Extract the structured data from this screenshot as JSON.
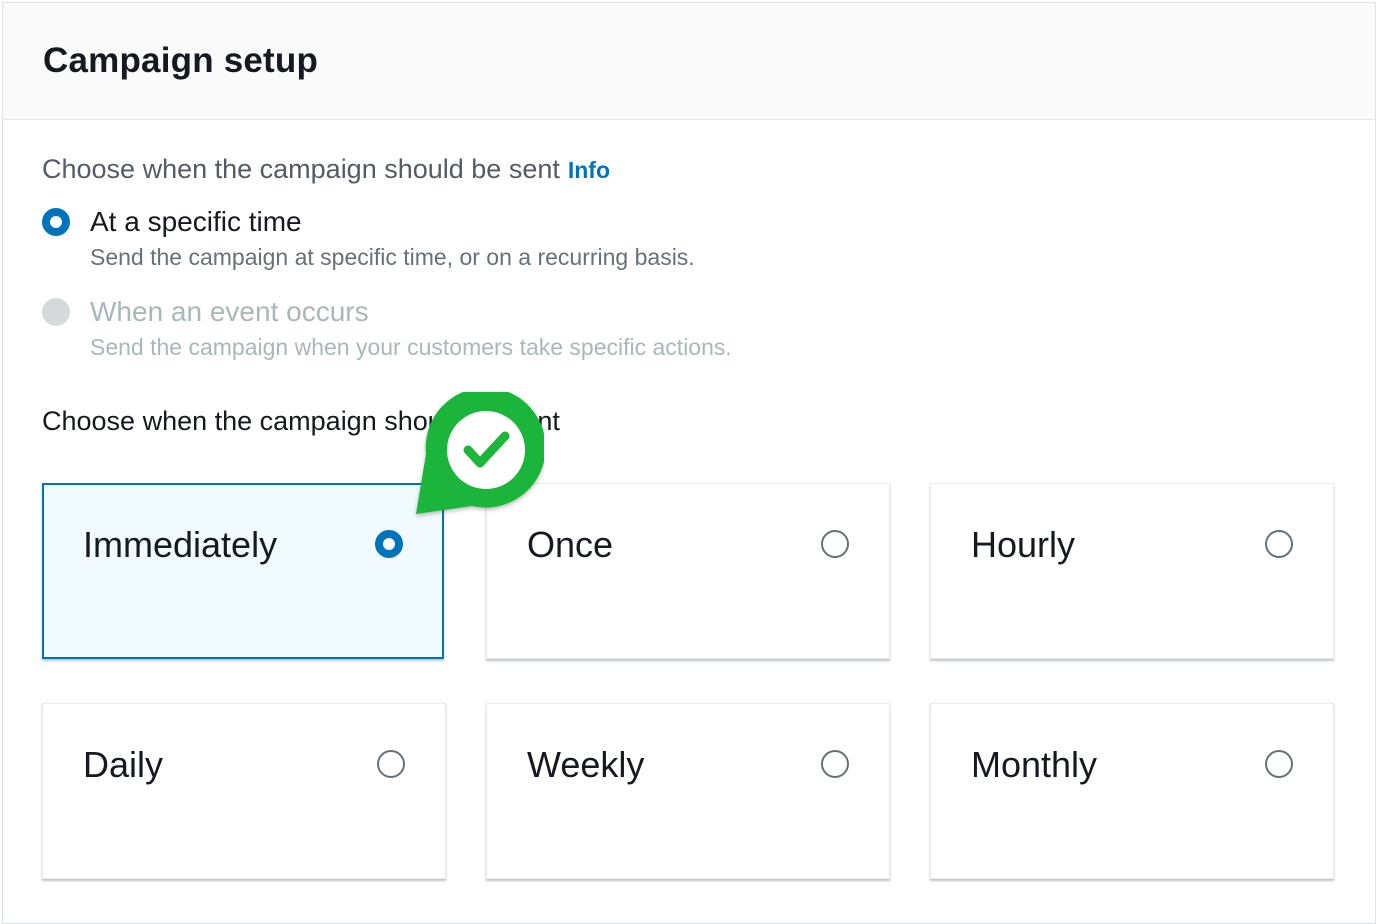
{
  "header": {
    "title": "Campaign setup"
  },
  "send_mode": {
    "label": "Choose when the campaign should be sent",
    "info_link": "Info",
    "options": [
      {
        "label": "At a specific time",
        "description": "Send the campaign at specific time, or on a recurring basis.",
        "state": "selected"
      },
      {
        "label": "When an event occurs",
        "description": "Send the campaign when your customers take specific actions.",
        "state": "disabled"
      }
    ]
  },
  "frequency": {
    "label": "Choose when the campaign should be sent",
    "options": [
      {
        "label": "Immediately",
        "selected": true
      },
      {
        "label": "Once",
        "selected": false
      },
      {
        "label": "Hourly",
        "selected": false
      },
      {
        "label": "Daily",
        "selected": false
      },
      {
        "label": "Weekly",
        "selected": false
      },
      {
        "label": "Monthly",
        "selected": false
      }
    ]
  },
  "colors": {
    "accent": "#0073bb",
    "selected_tile_bg": "#f1faff",
    "badge_green": "#1db53a"
  },
  "icons": {
    "overlay": "green-check-badge-icon"
  }
}
